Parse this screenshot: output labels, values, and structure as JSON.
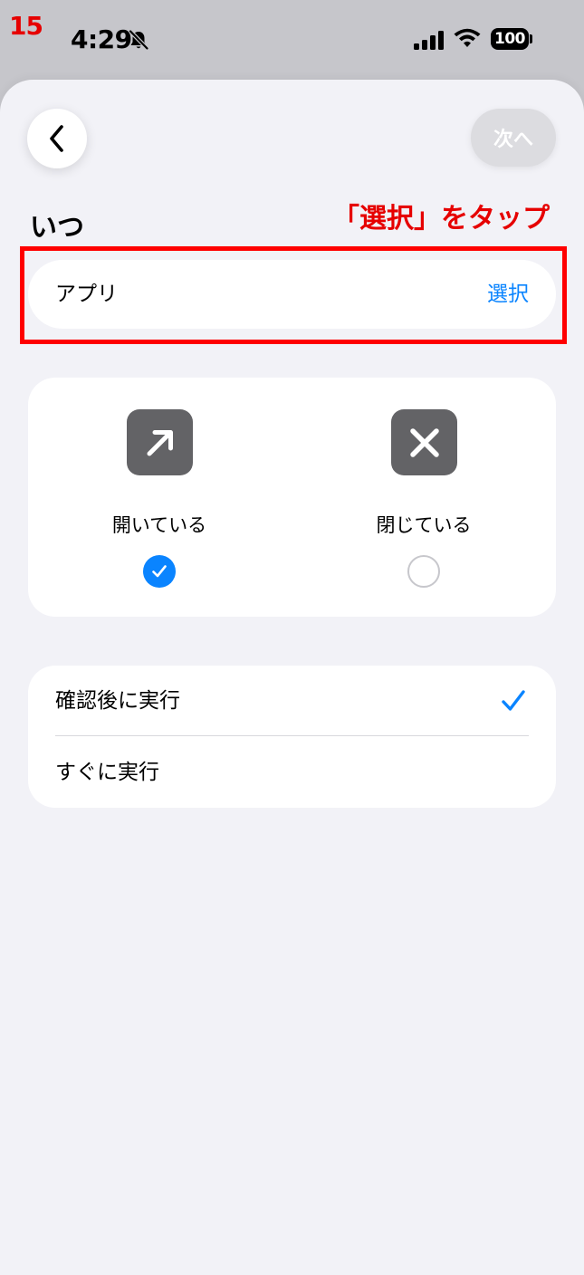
{
  "overlay": {
    "step_number": "15",
    "annotation": "「選択」をタップ",
    "annotation_color": "#e60000"
  },
  "status_bar": {
    "time": "4:29",
    "battery": "100",
    "icons": [
      "bell-slash-icon",
      "signal-icon",
      "wifi-icon",
      "battery-icon"
    ]
  },
  "nav": {
    "back_icon": "chevron-left-icon",
    "next_label": "次へ"
  },
  "section": {
    "title": "いつ"
  },
  "app_row": {
    "label": "アプリ",
    "action": "選択"
  },
  "app_state": {
    "options": [
      {
        "label": "開いている",
        "icon": "arrow-up-right-icon",
        "selected": true
      },
      {
        "label": "閉じている",
        "icon": "x-mark-icon",
        "selected": false
      }
    ]
  },
  "run_mode": {
    "options": [
      {
        "label": "確認後に実行",
        "selected": true
      },
      {
        "label": "すぐに実行",
        "selected": false
      }
    ]
  },
  "colors": {
    "accent": "#0a84ff",
    "background": "#f2f2f7",
    "icon_tile": "#636366"
  }
}
